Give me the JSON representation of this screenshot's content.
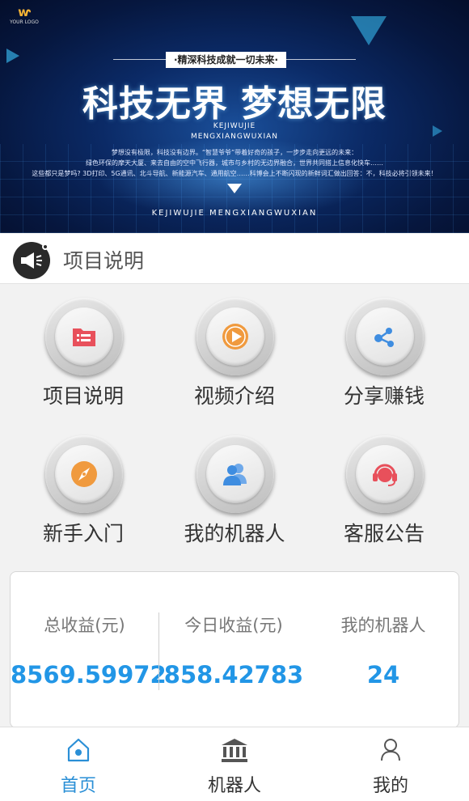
{
  "banner": {
    "logo_text": "YOUR LOGO",
    "slogan_top": "·精深科技成就一切未来·",
    "title": "科技无界 梦想无限",
    "subtitle_line1": "KEJIWUJIE",
    "subtitle_line2": "MENGXIANGWUXIAN",
    "desc_line1": "梦想没有极限，科技没有边界。“智慧爷爷”带着好奇的孩子，一步步走向更远的未来：",
    "desc_line2": "绿色环保的摩天大厦、来去自由的空中飞行器，城市与乡村的无边界融合，世界共同搭上信息化快车……",
    "desc_line3": "这些都只是梦吗? 3D打印、5G通讯、北斗导航、新能源汽车、通用航空……科博会上不断闪现的新鲜词汇做出回答：不，科技必将引领未来！",
    "bottom_tag": "KEJIWUJIE MENGXIANGWUXIAN"
  },
  "notice": {
    "text": "项目说明"
  },
  "menu": [
    {
      "label": "项目说明",
      "icon": "list-icon",
      "color": "#e8505b"
    },
    {
      "label": "视频介绍",
      "icon": "play-icon",
      "color": "#f09a3e"
    },
    {
      "label": "分享赚钱",
      "icon": "share-icon",
      "color": "#3f8de0"
    },
    {
      "label": "新手入门",
      "icon": "compass-icon",
      "color": "#f09a3e"
    },
    {
      "label": "我的机器人",
      "icon": "users-icon",
      "color": "#3f8de0"
    },
    {
      "label": "客服公告",
      "icon": "headset-icon",
      "color": "#e8505b"
    }
  ],
  "stats": {
    "total_label": "总收益(元)",
    "total_value": "8569.59972",
    "today_label": "今日收益(元)",
    "today_value": "858.42783",
    "robots_label": "我的机器人",
    "robots_value": "24"
  },
  "tabbar": {
    "home": "首页",
    "robot": "机器人",
    "mine": "我的"
  },
  "colors": {
    "accent": "#2a8fd6",
    "value_blue": "#2296e6"
  }
}
